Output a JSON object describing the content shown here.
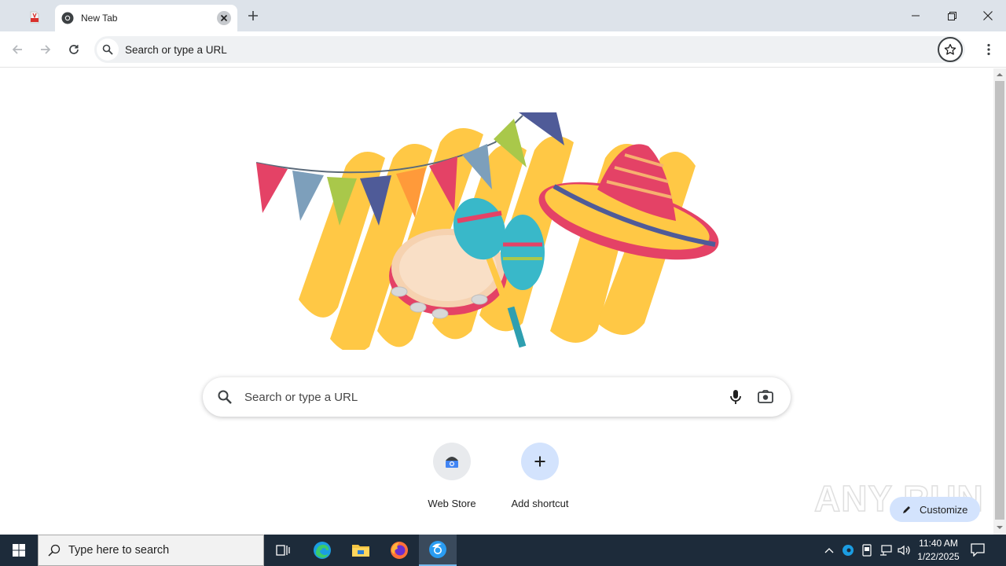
{
  "browser": {
    "tabs": [
      {
        "title": "New Tab",
        "active": true
      }
    ],
    "omnibox": {
      "placeholder": "Search or type a URL"
    }
  },
  "ntp": {
    "search_placeholder": "Search or type a URL",
    "shortcuts": [
      {
        "label": "Web Store",
        "icon": "web-store-icon"
      },
      {
        "label": "Add shortcut",
        "icon": "plus-icon"
      }
    ],
    "customize_label": "Customize",
    "watermark": "ANY RUN"
  },
  "taskbar": {
    "search_placeholder": "Type here to search",
    "apps": [
      "task-view-icon",
      "edge-icon",
      "file-explorer-icon",
      "firefox-icon",
      "chrome-canary-icon"
    ],
    "clock": {
      "time": "11:40 AM",
      "date": "1/22/2025"
    }
  },
  "colors": {
    "tabstrip": "#dde3ea",
    "omnibox": "#eff1f3",
    "customize_bg": "#d3e3fd",
    "taskbar": "#1d2b3a",
    "doodle_yellow": "#ffc845"
  }
}
